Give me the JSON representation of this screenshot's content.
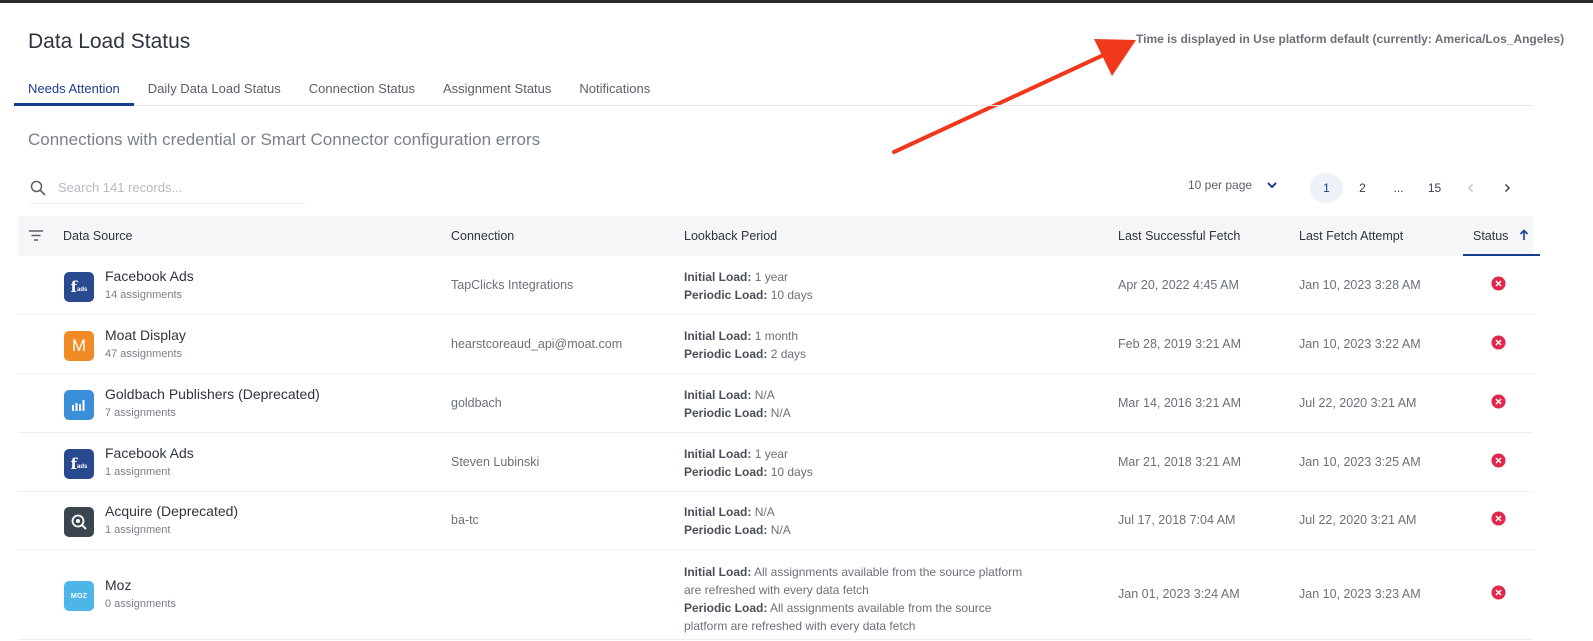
{
  "page": {
    "title": "Data Load Status",
    "timezone_note": "Time is displayed in Use platform default (currently: America/Los_Angeles)",
    "subtitle": "Connections with credential or Smart Connector configuration errors"
  },
  "tabs": [
    {
      "label": "Needs Attention",
      "active": true
    },
    {
      "label": "Daily Data Load Status",
      "active": false
    },
    {
      "label": "Connection Status",
      "active": false
    },
    {
      "label": "Assignment Status",
      "active": false
    },
    {
      "label": "Notifications",
      "active": false
    }
  ],
  "search": {
    "placeholder": "Search 141 records..."
  },
  "pagination": {
    "per_page": "10 per page",
    "pages": [
      "1",
      "2",
      "...",
      "15"
    ],
    "current": "1"
  },
  "table": {
    "columns": {
      "data_source": "Data Source",
      "connection": "Connection",
      "lookback": "Lookback Period",
      "last_success": "Last Successful Fetch",
      "last_attempt": "Last Fetch Attempt",
      "status": "Status"
    },
    "lookback_labels": {
      "initial": "Initial Load:",
      "periodic": "Periodic Load:"
    },
    "rows": [
      {
        "source": "Facebook Ads",
        "assignments": "14 assignments",
        "logo": "f",
        "logo_color": "#2a4a8f",
        "connection": "TapClicks Integrations",
        "initial": "1 year",
        "periodic": "10 days",
        "last_success": "Apr 20, 2022 4:45 AM",
        "last_attempt": "Jan 10, 2023 3:28 AM"
      },
      {
        "source": "Moat Display",
        "assignments": "47 assignments",
        "logo": "M",
        "logo_color": "#f28b26",
        "connection": "hearstcoreaud_api@moat.com",
        "initial": "1 month",
        "periodic": "2 days",
        "last_success": "Feb 28, 2019 3:21 AM",
        "last_attempt": "Jan 10, 2023 3:22 AM"
      },
      {
        "source": "Goldbach Publishers (Deprecated)",
        "assignments": "7 assignments",
        "logo": "bars",
        "logo_color": "#3b8fd8",
        "connection": "goldbach",
        "initial": "N/A",
        "periodic": "N/A",
        "last_success": "Mar 14, 2016 3:21 AM",
        "last_attempt": "Jul 22, 2020 3:21 AM"
      },
      {
        "source": "Facebook Ads",
        "assignments": "1 assignment",
        "logo": "f",
        "logo_color": "#2a4a8f",
        "connection": "Steven Lubinski",
        "initial": "1 year",
        "periodic": "10 days",
        "last_success": "Mar 21, 2018 3:21 AM",
        "last_attempt": "Jan 10, 2023 3:25 AM"
      },
      {
        "source": "Acquire (Deprecated)",
        "assignments": "1 assignment",
        "logo": "magnifier",
        "logo_color": "#3a4550",
        "connection": "ba-tc",
        "initial": "N/A",
        "periodic": "N/A",
        "last_success": "Jul 17, 2018 7:04 AM",
        "last_attempt": "Jul 22, 2020 3:21 AM"
      },
      {
        "source": "Moz",
        "assignments": "0 assignments",
        "logo": "MOZ",
        "logo_color": "#4db6e6",
        "connection": "",
        "initial": "All assignments available from the source platform are refreshed with every data fetch",
        "periodic": "All assignments available from the source platform are refreshed with every data fetch",
        "last_success": "Jan 01, 2023 3:24 AM",
        "last_attempt": "Jan 10, 2023 3:23 AM"
      }
    ]
  },
  "colors": {
    "accent": "#1a3e8f",
    "error": "#e0294a",
    "arrow": "#f0391c"
  }
}
